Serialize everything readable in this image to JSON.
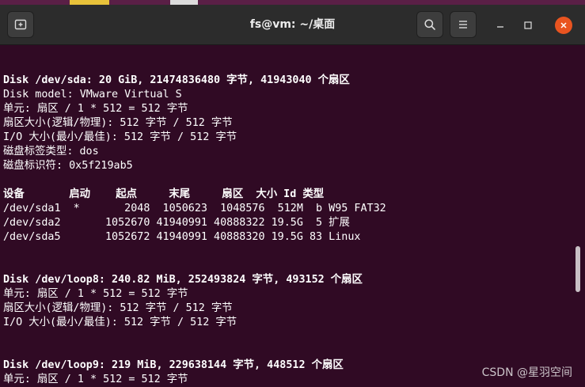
{
  "window": {
    "title": "fs@vm: ~/桌面",
    "buttons": {
      "new_tab_icon": "new-tab-icon",
      "search_icon": "search-icon",
      "menu_icon": "hamburger-menu-icon",
      "minimize_icon": "minimize-icon",
      "maximize_icon": "maximize-icon",
      "close_icon": "close-icon"
    },
    "colors": {
      "terminal_bg": "#300a24",
      "titlebar_bg": "#2c2c2c",
      "close_button": "#e95420",
      "text": "#ffffff"
    }
  },
  "terminal": {
    "lines": [
      "",
      "",
      "Disk /dev/sda: 20 GiB, 21474836480 字节, 41943040 个扇区",
      "Disk model: VMware Virtual S",
      "单元: 扇区 / 1 * 512 = 512 字节",
      "扇区大小(逻辑/物理): 512 字节 / 512 字节",
      "I/O 大小(最小/最佳): 512 字节 / 512 字节",
      "磁盘标签类型: dos",
      "磁盘标识符: 0x5f219ab5",
      "",
      "设备       启动    起点     末尾     扇区  大小 Id 类型",
      "/dev/sda1  *       2048  1050623  1048576  512M  b W95 FAT32",
      "/dev/sda2       1052670 41940991 40888322 19.5G  5 扩展",
      "/dev/sda5       1052672 41940991 40888320 19.5G 83 Linux",
      "",
      "",
      "Disk /dev/loop8: 240.82 MiB, 252493824 字节, 493152 个扇区",
      "单元: 扇区 / 1 * 512 = 512 字节",
      "扇区大小(逻辑/物理): 512 字节 / 512 字节",
      "I/O 大小(最小/最佳): 512 字节 / 512 字节",
      "",
      "",
      "Disk /dev/loop9: 219 MiB, 229638144 字节, 448512 个扇区",
      "单元: 扇区 / 1 * 512 = 512 字节"
    ],
    "bold_lines": [
      2,
      10,
      16,
      22
    ]
  },
  "watermark": "CSDN @星羽空间"
}
